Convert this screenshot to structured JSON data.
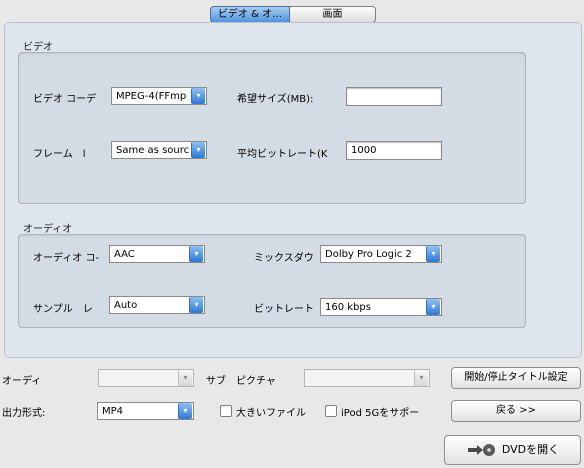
{
  "tabs": [
    "ビデオ & オ…",
    "画面"
  ],
  "video": {
    "group_title": "ビデオ",
    "codec_label": "ビデオ コーデ",
    "codec_value": "MPEG-4(FFmp",
    "size_label": "希望サイズ(MB):",
    "size_value": "",
    "frame_label": "フレーム　l",
    "frame_value": "Same as sourc",
    "bitrate_label": "平均ビットレート(K",
    "bitrate_value": "1000"
  },
  "audio": {
    "group_title": "オーディオ",
    "codec_label": "オーディオ コ-",
    "codec_value": "AAC",
    "mixdown_label": "ミックスダウ",
    "mixdown_value": "Dolby Pro Logic 2",
    "sample_label": "サンプル　レ",
    "sample_value": "Auto",
    "bitrate_label": "ビットレート",
    "bitrate_value": "160 kbps"
  },
  "bottom": {
    "audio_label": "オーディ",
    "audio_value": "",
    "subtitle_label": "サブ　ピクチャ",
    "subtitle_value": "",
    "chapter_button": "開始/停止タイトル設定",
    "format_label": "出力形式:",
    "format_value": "MP4",
    "large_file_label": "大きいファイル",
    "ipod_label": "iPod 5Gをサポー",
    "back_button": "戻る >>",
    "open_dvd_button": "DVDを開く"
  },
  "icons": {
    "select_arrow": "▾",
    "dvd": "disc-icon"
  }
}
